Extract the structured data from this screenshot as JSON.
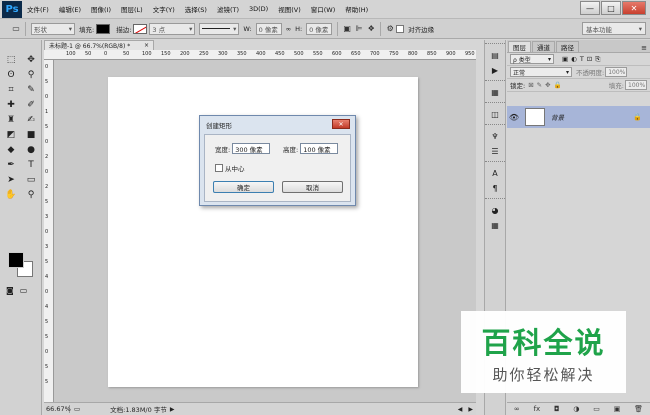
{
  "app": {
    "logo": "Ps"
  },
  "menu": [
    "文件(F)",
    "编辑(E)",
    "图像(I)",
    "图层(L)",
    "文字(Y)",
    "选择(S)",
    "滤镜(T)",
    "3D(D)",
    "视图(V)",
    "窗口(W)",
    "帮助(H)"
  ],
  "window_controls": {
    "minimize": "—",
    "maximize": "□",
    "close": "✕"
  },
  "options_bar": {
    "mode_value": "形状",
    "fill_label": "填充:",
    "stroke_label": "描边:",
    "stroke_width": "3 点",
    "w_label": "W:",
    "w_value": "0 像素",
    "link_icon": "∞",
    "h_label": "H:",
    "h_value": "0 像素",
    "align_edges_label": "对齐边缘",
    "workspace": "基本功能"
  },
  "document": {
    "tab_title": "未标题-1 @ 66.7%(RGB/8) *",
    "tab_close": "×",
    "ruler_h": [
      "100",
      "50",
      "0",
      "50",
      "100",
      "150",
      "200",
      "250",
      "300",
      "350",
      "400",
      "450",
      "500",
      "550",
      "600",
      "650",
      "700",
      "750",
      "800",
      "850",
      "900",
      "950"
    ],
    "ruler_v": [
      "0",
      "5",
      "0",
      "1",
      "5",
      "0",
      "2",
      "0",
      "2",
      "5",
      "3",
      "0",
      "3",
      "5",
      "4",
      "0",
      "4",
      "5",
      "5",
      "0",
      "5",
      "5"
    ]
  },
  "status": {
    "zoom": "66.67%",
    "doc_info": "文档:1.83M/0 字节"
  },
  "dialog": {
    "title": "创建矩形",
    "width_label": "宽度:",
    "width_value": "300 像素",
    "height_label": "高度:",
    "height_value": "100 像素",
    "from_center_label": "从中心",
    "ok_label": "确定",
    "cancel_label": "取消"
  },
  "layers_panel": {
    "tabs": [
      "图层",
      "通道",
      "路径"
    ],
    "kind_filter": "ρ 类型",
    "blend_mode": "正常",
    "opacity_label": "不透明度:",
    "opacity_value": "100%",
    "lock_label": "锁定:",
    "fill_label": "填充:",
    "fill_value": "100%",
    "layer_name": "背景",
    "footer_icons": [
      "∞",
      "fx",
      "◘",
      "◑",
      "▭",
      "▣",
      "🗑"
    ]
  },
  "watermark": {
    "title": "百科全说",
    "subtitle": "助你轻松解决"
  }
}
